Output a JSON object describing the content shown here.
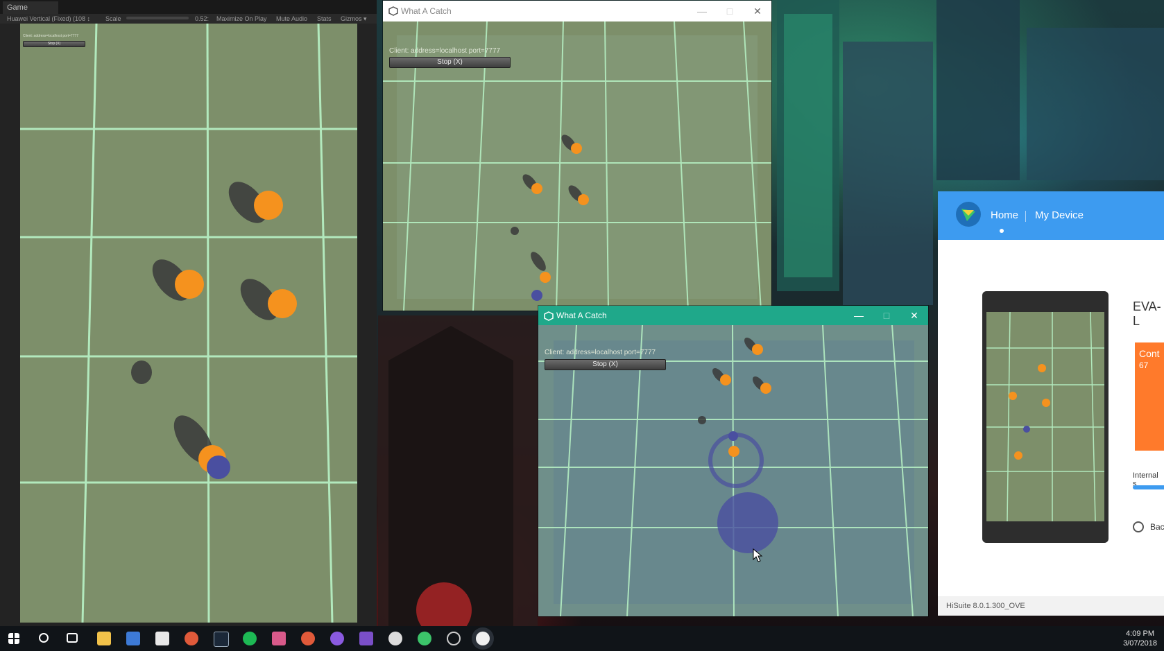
{
  "unity": {
    "tab": "Game",
    "toolbar": {
      "resolution": "Huawei Vertical (Fixed) (108 ↕",
      "scale_label": "Scale",
      "scale_value": "0.52:",
      "maximize": "Maximize On Play",
      "mute": "Mute Audio",
      "stats": "Stats",
      "gizmos": "Gizmos ▾"
    },
    "client_text": "Client: address=localhost port=7777",
    "stop_label": "Stop (X)"
  },
  "window_back": {
    "title": "What A Catch",
    "client_text": "Client: address=localhost port=7777",
    "stop_label": "Stop (X)"
  },
  "window_front": {
    "title": "What A Catch",
    "client_text": "Client: address=localhost port=7777",
    "stop_label": "Stop (X)"
  },
  "hisuite": {
    "nav_home": "Home",
    "nav_device": "My Device",
    "device_name": "EVA-L",
    "panel_text_1": "Cont",
    "panel_text_2": "67",
    "storage_label": "Internal s",
    "backup_label": "Bac",
    "version": "HiSuite 8.0.1.300_OVE",
    "accent": "#3d9bf0",
    "orange": "#ff7a2b"
  },
  "taskbar": {
    "time": "4:09 PM",
    "date": "3/07/2018"
  },
  "colors": {
    "grid": "#b8f3c6",
    "ball": "#f5921e",
    "player": "#4a4fa0",
    "title_active": "#1fa88a"
  }
}
